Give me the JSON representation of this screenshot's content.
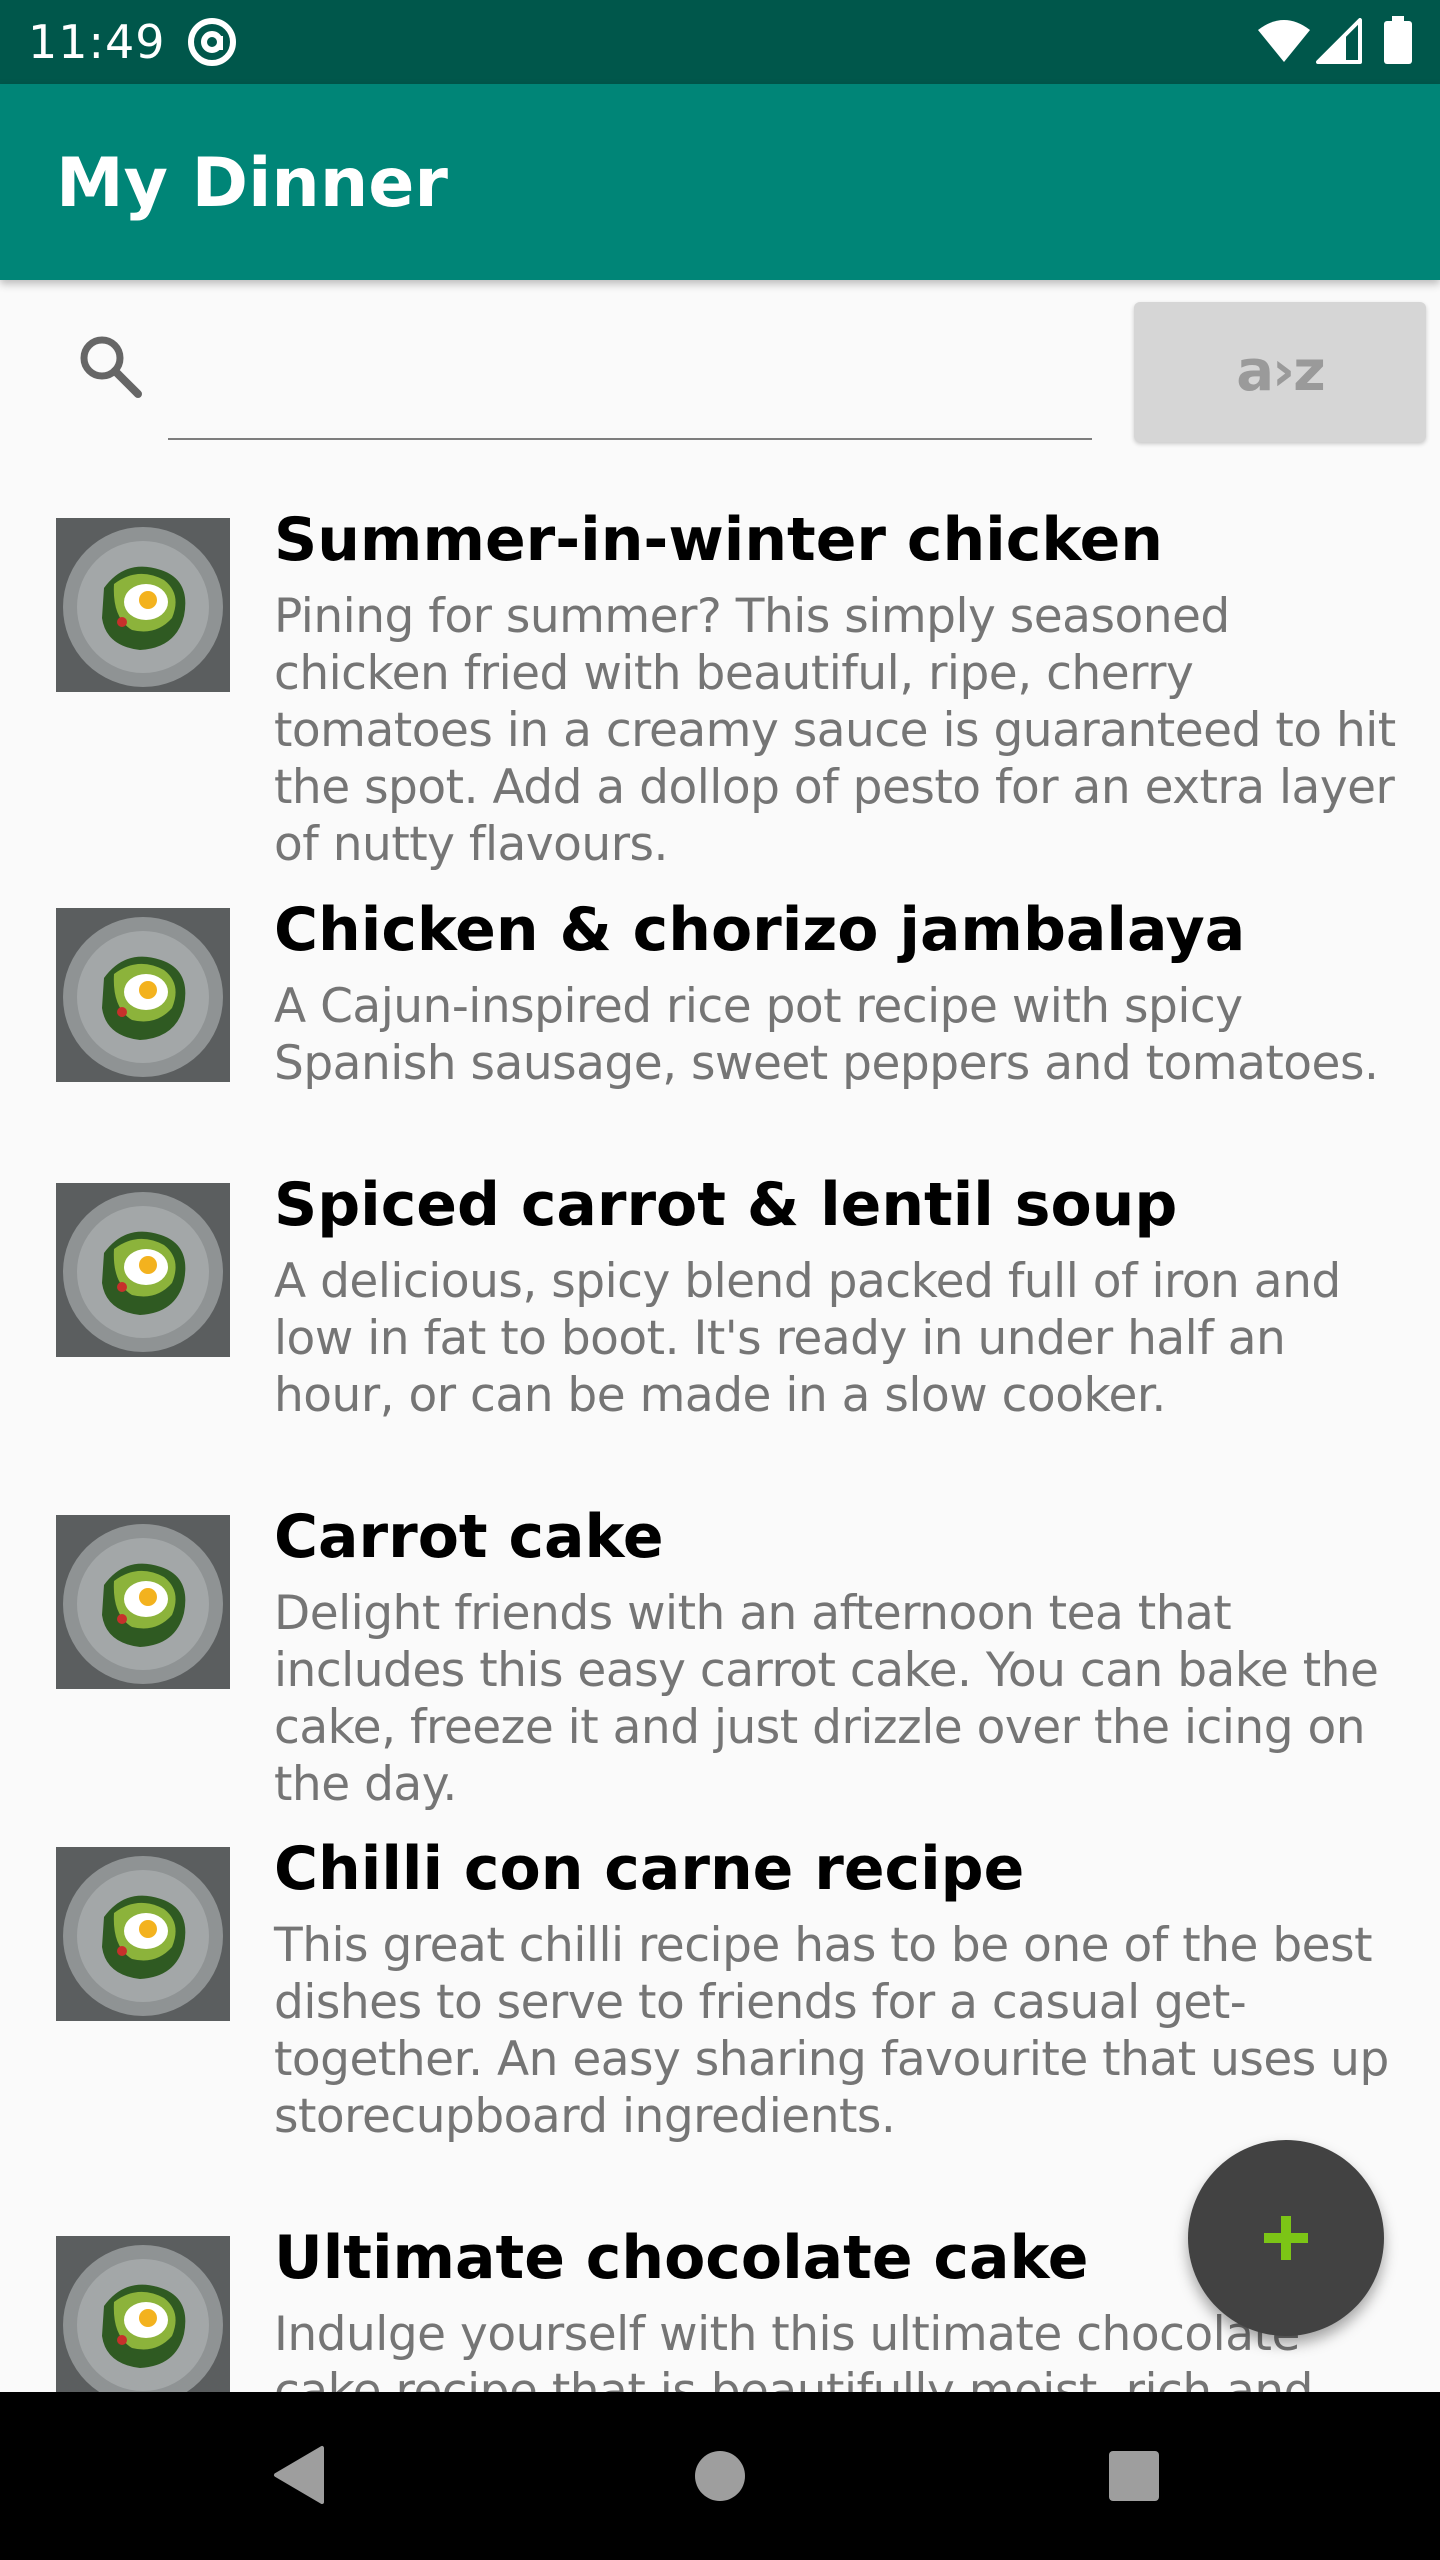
{
  "status_bar": {
    "time": "11:49",
    "icons": [
      "at-sign-icon",
      "wifi-icon",
      "signal-icon",
      "battery-icon"
    ]
  },
  "app_bar": {
    "title": "My Dinner"
  },
  "search": {
    "icon": "search-icon",
    "value": "",
    "placeholder": ""
  },
  "sort_button": {
    "label": "a›z"
  },
  "recipes": [
    {
      "title": "Summer-in-winter chicken",
      "description": "Pining for summer? This simply seasoned chicken fried with beautiful, ripe, cherry tomatoes in a creamy sauce is guaranteed to hit the spot. Add a dollop of pesto for an extra layer of nutty flavours."
    },
    {
      "title": "Chicken & chorizo jambalaya",
      "description": "A Cajun-inspired rice pot recipe with spicy Spanish sausage, sweet peppers and tomatoes."
    },
    {
      "title": "Spiced carrot & lentil soup",
      "description": "A delicious, spicy blend packed full of iron and low in fat to boot. It's ready in under half an hour, or can be made in a slow cooker."
    },
    {
      "title": "Carrot cake",
      "description": "Delight friends with an afternoon tea that includes this easy carrot cake. You can bake the cake, freeze it and just drizzle over the icing on the day."
    },
    {
      "title": "Chilli con carne recipe",
      "description": "This great chilli recipe has to be one of the best dishes to serve to friends for a casual get-together. An easy sharing favourite that uses up storecupboard ingredients."
    },
    {
      "title": "Ultimate chocolate cake",
      "description": "Indulge yourself with this ultimate chocolate cake recipe that is beautifully moist, rich and fudgy."
    }
  ],
  "fab": {
    "icon": "plus-icon"
  },
  "nav_bar": {
    "icons": [
      "back-icon",
      "home-icon",
      "recents-icon"
    ]
  },
  "colors": {
    "status_bar": "#00574b",
    "app_bar": "#008577",
    "fab": "#424242",
    "fab_icon": "#7cc516",
    "background": "#fafafa",
    "description_text": "#757575"
  }
}
